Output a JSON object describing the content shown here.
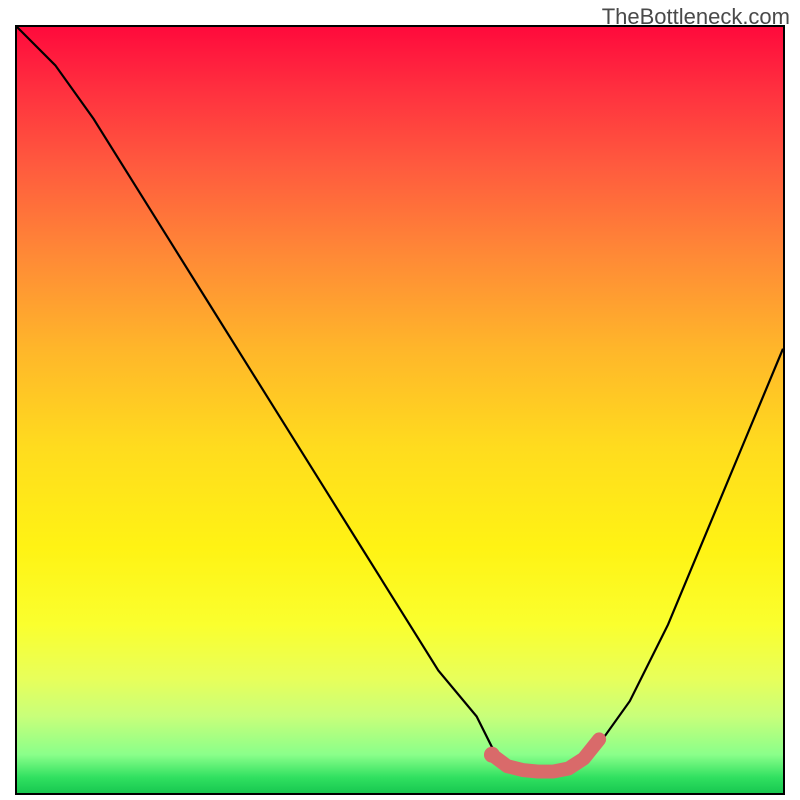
{
  "watermark": "TheBottleneck.com",
  "chart_data": {
    "type": "line",
    "title": "",
    "xlabel": "",
    "ylabel": "",
    "xlim": [
      0,
      100
    ],
    "ylim": [
      0,
      100
    ],
    "series": [
      {
        "name": "bottleneck-curve",
        "x": [
          0,
          5,
          10,
          15,
          20,
          25,
          30,
          35,
          40,
          45,
          50,
          55,
          60,
          62,
          64,
          66,
          68,
          70,
          72,
          75,
          80,
          85,
          90,
          95,
          100
        ],
        "values": [
          100,
          95,
          88,
          80,
          72,
          64,
          56,
          48,
          40,
          32,
          24,
          16,
          10,
          6,
          4,
          3,
          2.5,
          2.5,
          3,
          5,
          12,
          22,
          34,
          46,
          58
        ]
      },
      {
        "name": "optimal-zone-highlight",
        "x": [
          62,
          64,
          66,
          68,
          70,
          72,
          74,
          76
        ],
        "values": [
          5,
          3.5,
          3,
          2.8,
          2.8,
          3.2,
          4.5,
          7
        ]
      }
    ],
    "gradient_stops": [
      {
        "pos": 0,
        "color": "#ff0a3c"
      },
      {
        "pos": 8,
        "color": "#ff2f3f"
      },
      {
        "pos": 18,
        "color": "#ff5a3e"
      },
      {
        "pos": 30,
        "color": "#ff8a36"
      },
      {
        "pos": 42,
        "color": "#ffb62a"
      },
      {
        "pos": 55,
        "color": "#ffdc1e"
      },
      {
        "pos": 68,
        "color": "#fff314"
      },
      {
        "pos": 78,
        "color": "#faff2e"
      },
      {
        "pos": 85,
        "color": "#e8ff5a"
      },
      {
        "pos": 90,
        "color": "#c8ff7a"
      },
      {
        "pos": 95,
        "color": "#8aff8a"
      },
      {
        "pos": 98,
        "color": "#30e060"
      },
      {
        "pos": 100,
        "color": "#18c850"
      }
    ]
  }
}
